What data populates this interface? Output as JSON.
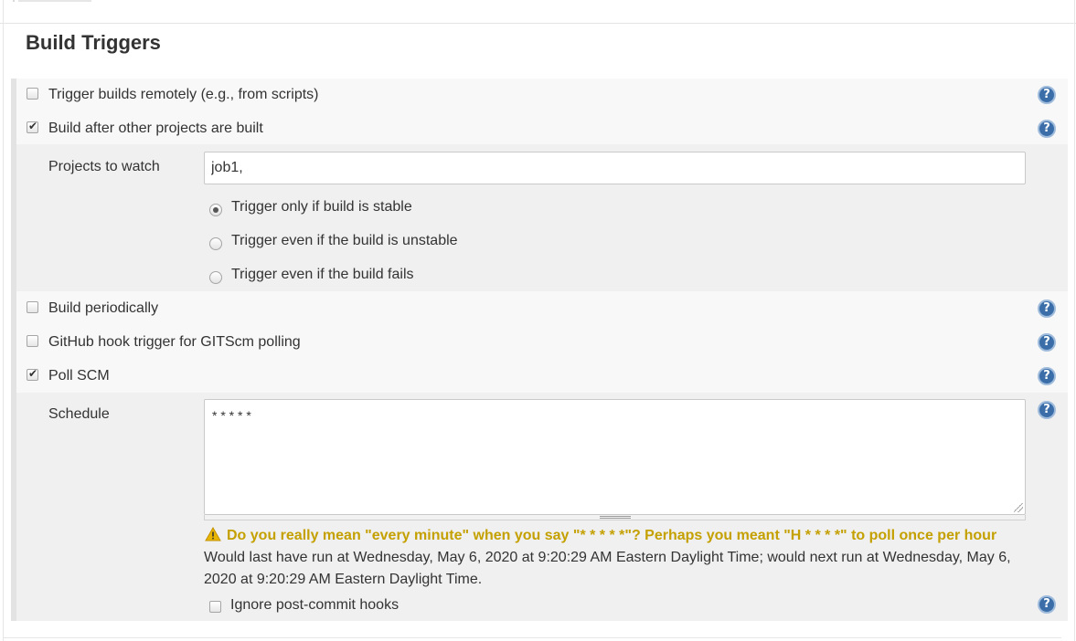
{
  "section": {
    "title": "Build Triggers"
  },
  "triggers": {
    "remote": {
      "label": "Trigger builds remotely (e.g., from scripts)",
      "checked": false
    },
    "after_other": {
      "label": "Build after other projects are built",
      "checked": true
    },
    "periodic": {
      "label": "Build periodically",
      "checked": false
    },
    "github_hook": {
      "label": "GitHub hook trigger for GITScm polling",
      "checked": false
    },
    "poll_scm": {
      "label": "Poll SCM",
      "checked": true
    }
  },
  "after_other_config": {
    "projects_label": "Projects to watch",
    "projects_value": "job1,",
    "radio_options": [
      {
        "label": "Trigger only if build is stable",
        "selected": true
      },
      {
        "label": "Trigger even if the build is unstable",
        "selected": false
      },
      {
        "label": "Trigger even if the build fails",
        "selected": false
      }
    ]
  },
  "poll_scm_config": {
    "schedule_label": "Schedule",
    "schedule_value": "* * * * *",
    "warning_text": "Do you really mean \"every minute\" when you say \"* * * * *\"? Perhaps you meant \"H * * * *\" to poll once per hour",
    "info_text": "Would last have run at Wednesday, May 6, 2020 at 9:20:29 AM Eastern Daylight Time; would next run at Wednesday, May 6, 2020 at 9:20:29 AM Eastern Daylight Time.",
    "ignore_hooks": {
      "label": "Ignore post-commit hooks",
      "checked": false
    }
  },
  "help": {
    "glyph": "?"
  },
  "colors": {
    "warning": "#c4a000",
    "help_blue": "#3b6ea8"
  }
}
